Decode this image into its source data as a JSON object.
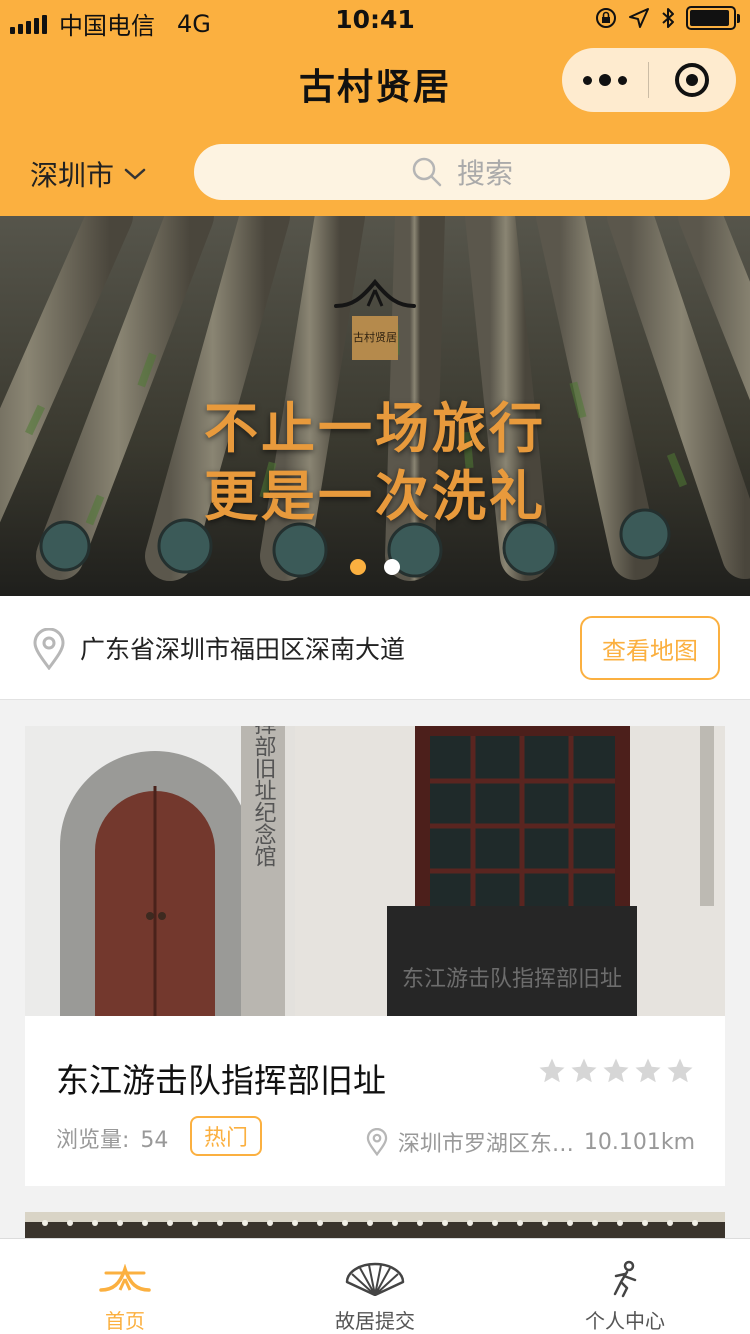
{
  "status_bar": {
    "carrier": "中国电信",
    "network": "4G",
    "time": "10:41"
  },
  "nav": {
    "title": "古村贤居"
  },
  "search": {
    "city": "深圳市",
    "placeholder": "搜索"
  },
  "banner": {
    "line1": "不止一场旅行",
    "line2": "更是一次洗礼",
    "logo_text": "古村贤居",
    "active_slide": 1,
    "slide_count": 2
  },
  "location": {
    "address": "广东省深圳市福田区深南大道",
    "map_button": "查看地图"
  },
  "cards": [
    {
      "title": "东江游击队指挥部旧址",
      "views_label": "浏览量:",
      "views": "54",
      "badge": "热门",
      "address": "深圳市罗湖区东…",
      "distance": "10.101km",
      "rating": 0,
      "sign_vertical": "游击队指挥部旧址纪念馆",
      "plaque": "东江游击队指挥部旧址"
    }
  ],
  "tab_bar": {
    "tabs": [
      {
        "label": "首页",
        "active": true
      },
      {
        "label": "故居提交",
        "active": false
      },
      {
        "label": "个人中心",
        "active": false
      }
    ]
  },
  "colors": {
    "primary": "#fbb040",
    "star_empty": "#d6d6d6",
    "text_muted": "#999999"
  }
}
